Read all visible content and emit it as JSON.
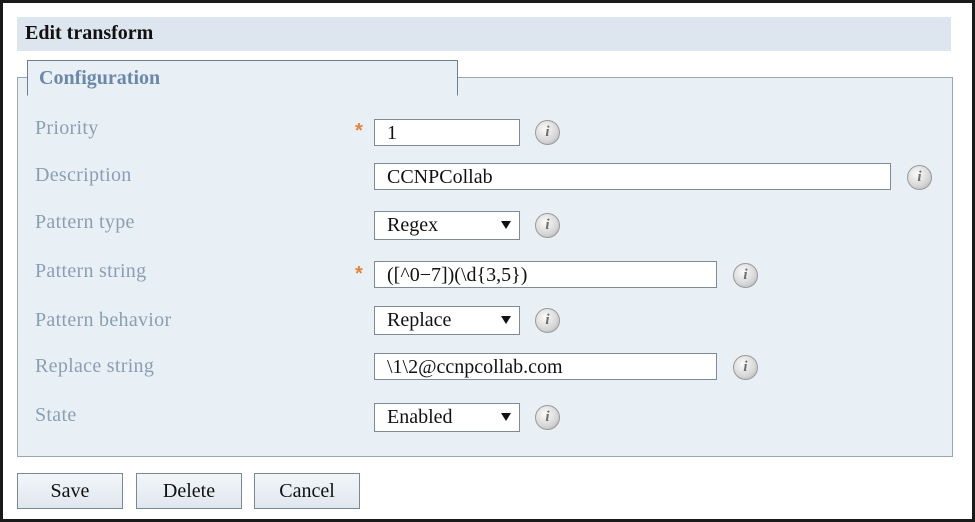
{
  "header": {
    "title": "Edit transform"
  },
  "section": {
    "legend": "Configuration"
  },
  "form": {
    "priority": {
      "label": "Priority",
      "required_mark": "*",
      "value": "1"
    },
    "description": {
      "label": "Description",
      "value": "CCNPCollab"
    },
    "pattern_type": {
      "label": "Pattern type",
      "value": "Regex"
    },
    "pattern_string": {
      "label": "Pattern string",
      "required_mark": "*",
      "value": "([^0−7])(\\d{3,5})"
    },
    "pattern_behavior": {
      "label": "Pattern behavior",
      "value": "Replace"
    },
    "replace_string": {
      "label": "Replace string",
      "value": "\\1\\2@ccnpcollab.com"
    },
    "state": {
      "label": "State",
      "value": "Enabled"
    }
  },
  "info_icon": {
    "glyph": "i"
  },
  "actions": {
    "save": "Save",
    "delete": "Delete",
    "cancel": "Cancel"
  },
  "colors": {
    "header_bg": "#dde6ee",
    "panel_bg": "#e8eff5",
    "legend_text": "#6b88a8",
    "label_text": "#8a9fb3",
    "required": "#e0863a"
  }
}
